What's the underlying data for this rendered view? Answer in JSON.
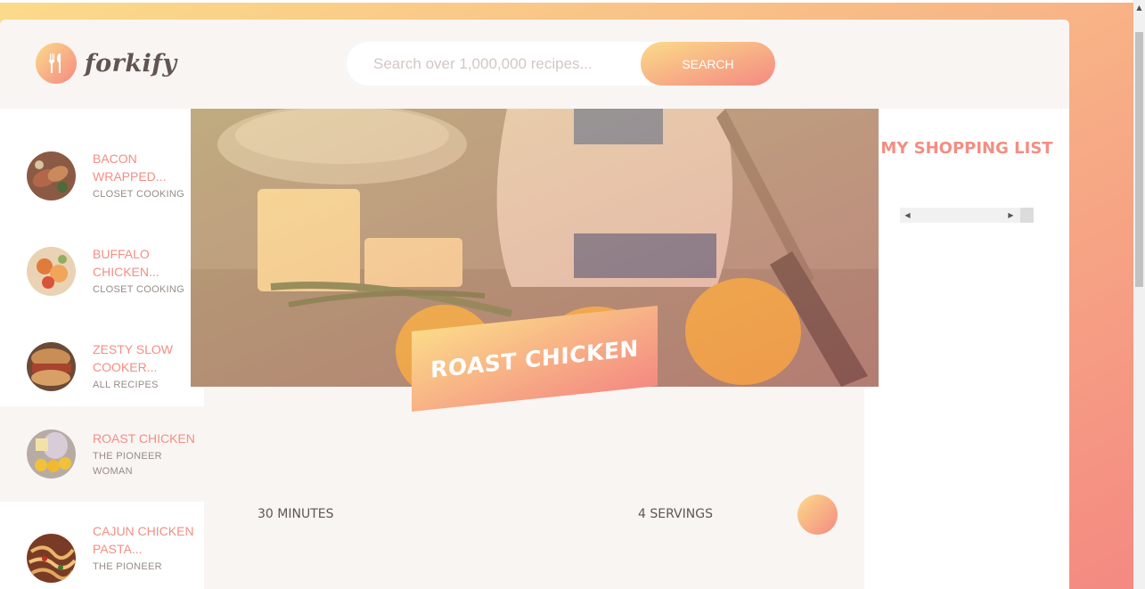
{
  "logo": {
    "text": "forkify",
    "icon": "fork-knife-icon"
  },
  "search": {
    "placeholder": "Search over 1,000,000 recipes...",
    "button_label": "SEARCH"
  },
  "results": [
    {
      "title": "Bacon Wrapped...",
      "author": "Closet Cooking",
      "active": false
    },
    {
      "title": "Buffalo Chicken...",
      "author": "Closet Cooking",
      "active": false
    },
    {
      "title": "Zesty Slow Cooker...",
      "author": "All Recipes",
      "active": false
    },
    {
      "title": "Roast Chicken",
      "author": "The Pioneer Woman",
      "active": true
    },
    {
      "title": "Cajun Chicken Pasta...",
      "author": "The Pioneer",
      "active": false
    }
  ],
  "recipe": {
    "title": "Roast Chicken",
    "minutes": "30 MINUTES",
    "servings": "4 SERVINGS"
  },
  "shopping": {
    "title": "My Shopping List"
  },
  "colors": {
    "accent": "#f38e82",
    "grad_start": "#fbdb89",
    "grad_end": "#f48982",
    "panel": "#f9f5f3"
  }
}
